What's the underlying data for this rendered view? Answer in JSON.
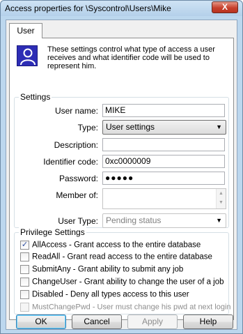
{
  "window": {
    "title": "Access properties for \\Syscontrol\\Users\\Mike",
    "close_glyph": "X"
  },
  "tabs": [
    {
      "label": "User"
    }
  ],
  "intro": "These settings control what type of access a user receives and what identifier code will be used to represent him.",
  "settings": {
    "legend": "Settings",
    "user_name": {
      "label": "User name:",
      "value": "MIKE"
    },
    "type": {
      "label": "Type:",
      "value": "User settings"
    },
    "description": {
      "label": "Description:",
      "value": ""
    },
    "identifier_code": {
      "label": "Identifier code:",
      "value": "0xc0000009"
    },
    "password": {
      "label": "Password:",
      "value": "●●●●●"
    },
    "member_of": {
      "label": "Member of:"
    },
    "user_type": {
      "label": "User Type:",
      "value": "Pending status"
    }
  },
  "privileges": {
    "legend": "Privilege Settings",
    "items": [
      {
        "label": "AllAccess - Grant access to the entire database",
        "checked": true,
        "enabled": true
      },
      {
        "label": "ReadAll - Grant read access to the entire database",
        "checked": false,
        "enabled": true
      },
      {
        "label": "SubmitAny - Grant ability to submit any job",
        "checked": false,
        "enabled": true
      },
      {
        "label": "ChangeUser - Grant ability to change the user of a job",
        "checked": false,
        "enabled": true
      },
      {
        "label": "Disabled - Deny all types access to this user",
        "checked": false,
        "enabled": true
      },
      {
        "label": "MustChangePwd - User must change his pwd at next login",
        "checked": false,
        "enabled": false
      }
    ]
  },
  "buttons": {
    "ok": "OK",
    "cancel": "Cancel",
    "apply": "Apply",
    "help": "Help"
  },
  "colors": {
    "window_frame": "#bcd7ee",
    "user_icon": "#2d2db5",
    "close_button": "#c7412d"
  }
}
